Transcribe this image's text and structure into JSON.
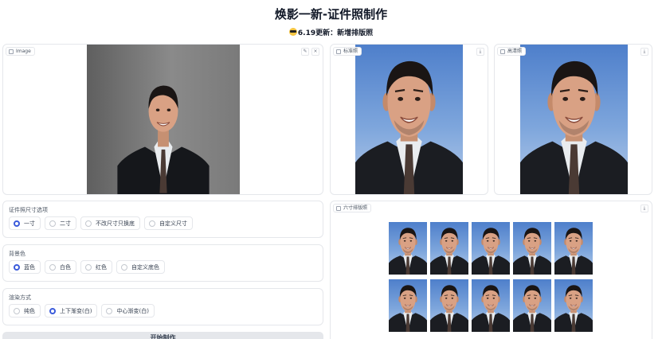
{
  "header": {
    "title": "焕影一新-证件照制作",
    "subtitle": "6.19更新：新增排版照"
  },
  "panels": {
    "image_label": "Image",
    "standard_label": "标准照",
    "hd_label": "高清照",
    "layout_label": "六寸排版照"
  },
  "size_options": {
    "label": "证件照尺寸选项",
    "items": [
      "一寸",
      "二寸",
      "不改尺寸只换底",
      "自定义尺寸"
    ],
    "selected": "一寸"
  },
  "bg_options": {
    "label": "背景色",
    "items": [
      "蓝色",
      "白色",
      "红色",
      "自定义底色"
    ],
    "selected": "蓝色"
  },
  "render_options": {
    "label": "渲染方式",
    "items": [
      "纯色",
      "上下渐变(白)",
      "中心渐变(白)"
    ],
    "selected": "上下渐变(白)"
  },
  "actions": {
    "start_label": "开始制作"
  },
  "colors": {
    "accent": "#3b5bdb",
    "photo_blue": "#4e7fcb"
  },
  "icons": {
    "edit": "pencil-icon",
    "clear": "close-icon",
    "download": "download-icon",
    "image": "image-icon"
  }
}
